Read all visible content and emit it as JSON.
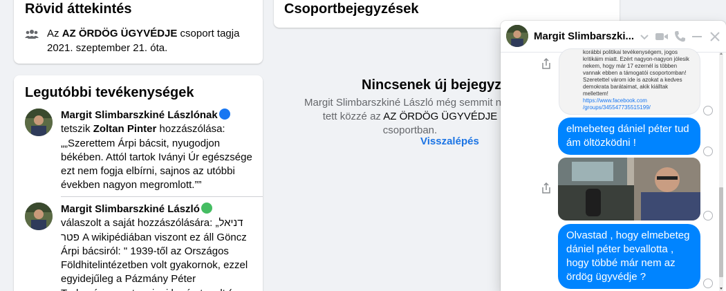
{
  "overview": {
    "title": "Rövid áttekintés",
    "pre": "Az ",
    "group": "AZ ÖRDÖG ÜGYVÉDJE",
    "post": " csoport tagja 2021. szeptember 21. óta."
  },
  "recent": {
    "title": "Legutóbbi tevékenységek",
    "items": [
      {
        "name": "Margit Slimbarszkiné Lászlónak",
        "mid": " tetszik ",
        "who": "Zoltan Pinter",
        "rest": " hozzászólása: „„Szerettem Árpi bácsit, nyugodjon békében. Attól tartok Iványi Úr egészsége ezt nem fogja elbírni, sajnos az utóbbi években nagyon megromlott.””"
      },
      {
        "name": "Margit Slimbarszkiné László",
        "rest": " válaszolt a saját hozzászólására: „דניאל פטר A wikipédiában viszont ez áll Göncz Árpi bácsiról: \" 1939-től az Országos Földhitelintézetben volt gyakornok, ezzel egyidejűleg a Pázmány Péter Tudományegyetem jogi karán tanult (s"
      }
    ]
  },
  "posts": {
    "title": "Csoportbejegyzések"
  },
  "empty": {
    "title": "Nincsenek új bejegyzések",
    "desc_pre": "Margit Slimbarszkiné László még semmit nem tett közzé az ",
    "desc_group": "AZ ÖRDÖG ÜGYVÉDJE",
    "desc_post": " csoportban.",
    "back": "Visszalépés"
  },
  "chat": {
    "name": "Margit Slimbarszki...",
    "attachment_lines": [
      "korábbi politikai tevékenységem, jogos",
      "kritikáim miatt. Ezért nagyon-nagyon jólesik",
      "nekem, hogy már 17 ezernél is többen",
      "vannak ebben a támogatói csoportomban!",
      "Szeretettel várom ide is azokat a kedves",
      "demokrata barátaimat, akik kiálltak",
      "mellettem!"
    ],
    "attachment_link1": "https://www.facebook.com",
    "attachment_link2": "/groups/345547735515199/",
    "messages": [
      "elmebeteg dániel péter tud ám öltözködni !",
      "Olvastad , hogy elmebeteg dániel péter bevallotta , hogy többé már nem az ördög ügyvédje ?"
    ]
  },
  "colors": {
    "accent": "#1877f2",
    "messenger_blue": "#0084ff",
    "link": "#1b74e4",
    "secondary_text": "#65676b"
  }
}
